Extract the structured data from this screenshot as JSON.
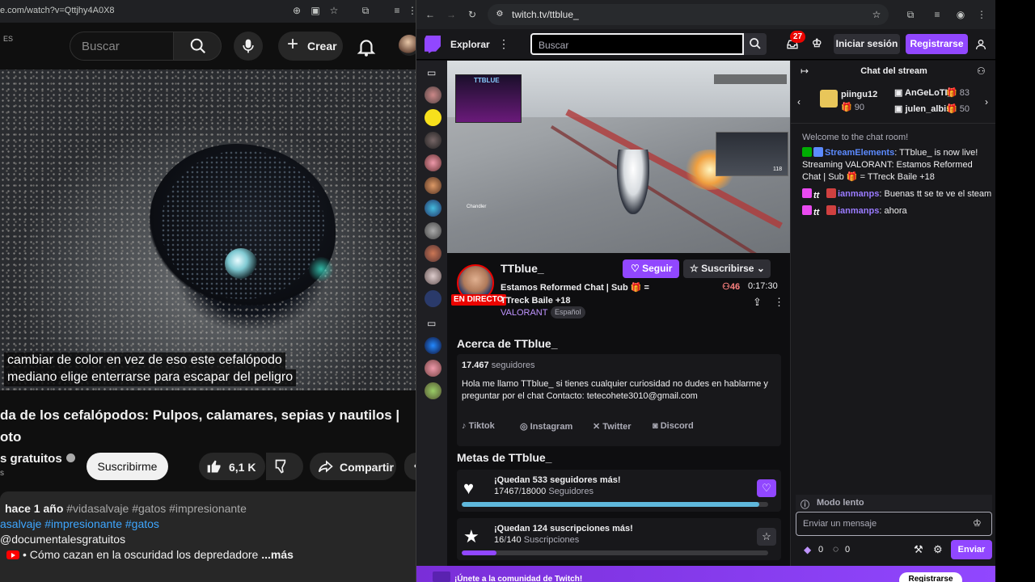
{
  "youtube": {
    "url": "e.com/watch?v=Qttjhy4A0X8",
    "lang": "ES",
    "search_placeholder": "Buscar",
    "create_label": "Crear",
    "captions": [
      "cambiar de color en vez de eso este cefalópodo",
      "mediano elige enterrarse para escapar del peligro"
    ],
    "title_line1": "da de los cefalópodos: Pulpos, calamares, sepias y nautilos |",
    "title_line2": "oto",
    "channel": "s gratuitos",
    "subscribe_label": "Suscribirme",
    "likes": "6,1 K",
    "share_label": "Compartir",
    "desc_time": "hace 1 año",
    "desc_tags1": "#vidasalvaje #gatos #impresionante",
    "desc_tags2": "asalvaje #impresionante #gatos",
    "desc_handle": "@documentalesgratuitos",
    "desc_link": "• Cómo cazan en la oscuridad los depredadore",
    "desc_more": "...más",
    "desc_s": "s"
  },
  "twitch": {
    "url": "twitch.tv/ttblue_",
    "explorar": "Explorar",
    "search_placeholder": "Buscar",
    "notif_count": "27",
    "login_label": "Iniciar sesión",
    "register_label": "Registrarse",
    "streamer": "TTblue_",
    "live_label": "EN DIRECTO",
    "follow_label": "Seguir",
    "subscribe_label": "Suscribirse",
    "stream_title": "Estamos Reformed Chat | Sub 🎁 = TTreck Baile +18",
    "game": "VALORANT",
    "language": "Español",
    "viewers": "46",
    "uptime": "0:17:30",
    "about_heading": "Acerca de TTblue_",
    "followers_count": "17.467",
    "followers_label": "seguidores",
    "bio": "Hola me llamo TTblue_ si tienes cualquier curiosidad no dudes en hablarme y preguntar por el chat Contacto: tetecohete3010@gmail.com",
    "socials": [
      "Tiktok",
      "Instagram",
      "Twitter",
      "Discord"
    ],
    "goals_heading": "Metas de TTblue_",
    "goals": [
      {
        "title": "¡Quedan 533 seguidores más!",
        "current": "17467",
        "target": "18000",
        "unit": "Seguidores",
        "progress": 0.97,
        "color": "#5fb8dc"
      },
      {
        "title": "¡Quedan 124 suscripciones más!",
        "current": "16",
        "target": "140",
        "unit": "Suscripciones",
        "progress": 0.114,
        "color": "#9147ff"
      }
    ],
    "banner_text": "¡Únete a la comunidad de Twitch!",
    "banner_button": "Registrarse",
    "hud": {
      "cam_label": "TTBLUE",
      "hud_score": "118",
      "player_tag": "Chandler"
    }
  },
  "chat": {
    "title": "Chat del stream",
    "gifters": [
      {
        "name": "piingu12",
        "count": "90"
      },
      {
        "name": "AnGeLoTI_",
        "count": "83"
      },
      {
        "name": "julen_albisu",
        "count": "50"
      }
    ],
    "welcome": "Welcome to the chat room!",
    "messages": [
      {
        "user": "StreamElements",
        "color": "#5c8bff",
        "text": "TTblue_ is now live! Streaming VALORANT: Estamos Reformed Chat | Sub 🎁 = TTreck Baile +18"
      },
      {
        "user": "ianmanps",
        "color": "#9a7bff",
        "text": "Buenas tt se te ve el steam"
      },
      {
        "user": "ianmanps",
        "color": "#9a7bff",
        "text": "ahora"
      }
    ],
    "slow_mode": "Modo lento",
    "input_placeholder": "Enviar un mensaje",
    "points_a": "0",
    "points_b": "0",
    "send_label": "Enviar"
  }
}
